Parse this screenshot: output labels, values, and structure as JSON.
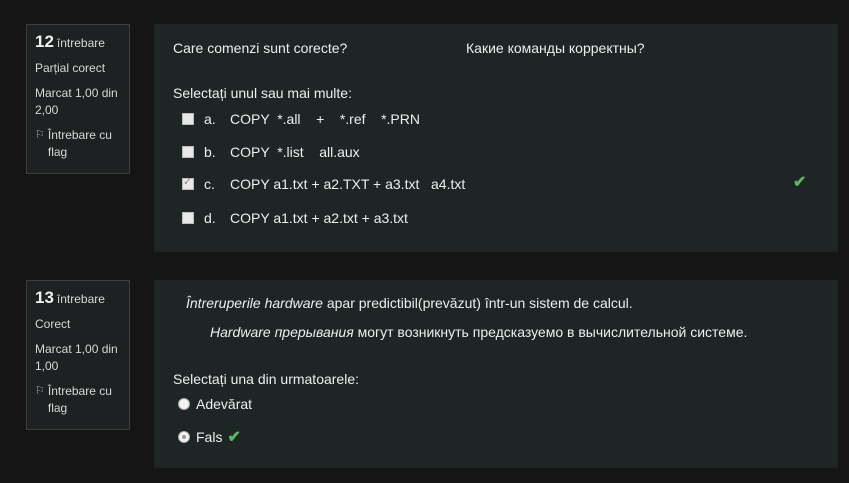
{
  "q12": {
    "number": "12",
    "word": "întrebare",
    "status": "Parțial corect",
    "mark": "Marcat 1,00 din 2,00",
    "flag_label": "Întrebare cu flag",
    "text_ro": "Care comenzi sunt corecte?",
    "text_ru": "Какие команды корректны?",
    "prompt": "Selectați unul sau mai multe:",
    "options": [
      {
        "letter": "a.",
        "text": "COPY  *.all    +    *.ref    *.PRN",
        "checked": false
      },
      {
        "letter": "b.",
        "text": "COPY  *.list    all.aux",
        "checked": false
      },
      {
        "letter": "c.",
        "text": "COPY a1.txt + a2.TXT + a3.txt   a4.txt",
        "checked": true
      },
      {
        "letter": "d.",
        "text": "COPY a1.txt + a2.txt + a3.txt",
        "checked": false
      }
    ]
  },
  "q13": {
    "number": "13",
    "word": "întrebare",
    "status": "Corect",
    "mark": "Marcat 1,00 din 1,00",
    "flag_label": "Întrebare cu flag",
    "text_ro_italic": "Întreruperile hardware",
    "text_ro_rest": " apar predictibil(prevăzut) într-un sistem de calcul.",
    "text_ru_italic": "Hardware прерывания",
    "text_ru_rest": " могут возникнуть предсказуемо в вычислительной системе.",
    "prompt": "Selectați una din urmatoarele:",
    "options": [
      {
        "text": "Adevărat",
        "checked": false
      },
      {
        "text": "Fals",
        "checked": true
      }
    ]
  },
  "icons": {
    "flag": "flag-icon",
    "check": "check-icon"
  },
  "colors": {
    "check": "#5cb85c",
    "panel": "#1e2525",
    "background": "#151515"
  }
}
